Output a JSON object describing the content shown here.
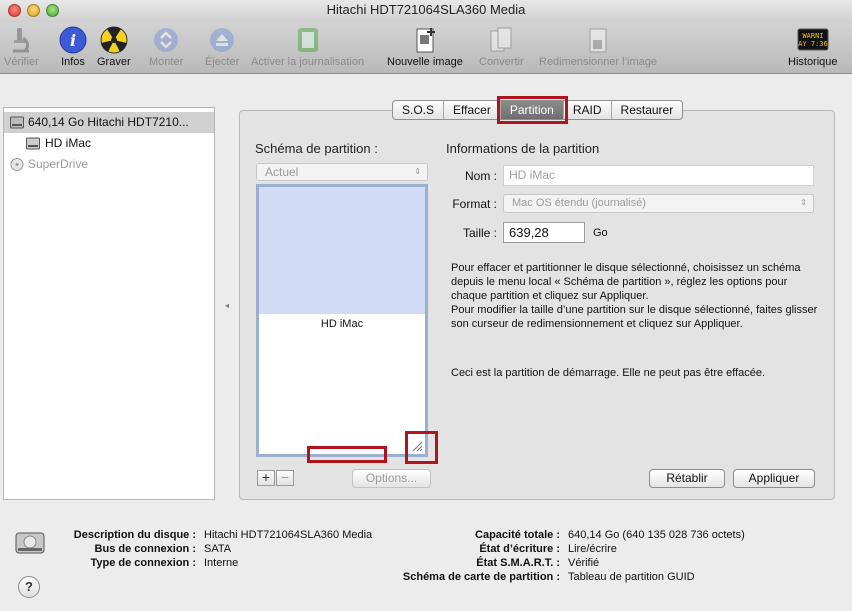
{
  "window": {
    "title": "Hitachi HDT721064SLA360 Media"
  },
  "toolbar": {
    "items": [
      {
        "label": "Vérifier",
        "icon": "microscope-icon",
        "enabled": false
      },
      {
        "label": "Infos",
        "icon": "info-icon",
        "enabled": true
      },
      {
        "label": "Graver",
        "icon": "burn-icon",
        "enabled": true
      },
      {
        "label": "Monter",
        "icon": "mount-icon",
        "enabled": false
      },
      {
        "label": "Éjecter",
        "icon": "eject-icon",
        "enabled": false
      },
      {
        "label": "Activer la journalisation",
        "icon": "journal-icon",
        "enabled": false
      },
      {
        "label": "Nouvelle image",
        "icon": "new-image-icon",
        "enabled": true
      },
      {
        "label": "Convertir",
        "icon": "convert-icon",
        "enabled": false
      },
      {
        "label": "Redimensionner l’image",
        "icon": "resize-image-icon",
        "enabled": false
      },
      {
        "label": "Historique",
        "icon": "log-icon",
        "enabled": true
      }
    ],
    "log_screen_lines": [
      "WARNI",
      "AY 7:36"
    ]
  },
  "sidebar": {
    "items": [
      {
        "label": "640,14 Go Hitachi HDT7210...",
        "icon": "hard-disk-icon",
        "selected": true
      },
      {
        "label": "HD iMac",
        "icon": "volume-icon",
        "selected": false
      },
      {
        "label": "SuperDrive",
        "icon": "optical-drive-icon",
        "selected": false
      }
    ]
  },
  "tabs": [
    "S.O.S",
    "Effacer",
    "Partition",
    "RAID",
    "Restaurer"
  ],
  "active_tab": "Partition",
  "partition": {
    "scheme_heading": "Schéma de partition :",
    "scheme_value": "Actuel",
    "layout_label": "HD iMac",
    "add_label": "+",
    "remove_label": "−",
    "options_label": "Options...",
    "info_heading": "Informations de la partition",
    "name_label": "Nom :",
    "name_value": "HD iMac",
    "format_label": "Format :",
    "format_value": "Mac OS étendu (journalisé)",
    "size_label": "Taille :",
    "size_value": "639,28",
    "size_unit": "Go",
    "help_text": "Pour effacer et partitionner le disque sélectionné, choisissez un schéma depuis le menu local « Schéma de partition », réglez les options pour chaque partition et cliquez sur Appliquer.\nPour modifier la taille d’une partition sur le disque sélectionné, faites glisser son curseur de redimensionnement et cliquez sur Appliquer.",
    "boot_note": "Ceci est la partition de démarrage. Elle ne peut pas être effacée.",
    "revert_label": "Rétablir",
    "apply_label": "Appliquer"
  },
  "disk_info": {
    "description_label": "Description du disque :",
    "description_value": "Hitachi HDT721064SLA360 Media",
    "bus_label": "Bus de connexion :",
    "bus_value": "SATA",
    "type_label": "Type de connexion :",
    "type_value": "Interne",
    "capacity_label": "Capacité totale :",
    "capacity_value": "640,14 Go (640 135 028 736 octets)",
    "write_label": "État d’écriture :",
    "write_value": "Lire/écrire",
    "smart_label": "État S.M.A.R.T. :",
    "smart_value": "Vérifié",
    "map_label": "Schéma de carte de partition :",
    "map_value": "Tableau de partition GUID"
  },
  "help_button_label": "?",
  "colors": {
    "highlight": "#b0141f",
    "partition_fill": "#d2dbf5",
    "partition_border": "#9bb0d0",
    "info_icon": "#3b5bd6"
  }
}
